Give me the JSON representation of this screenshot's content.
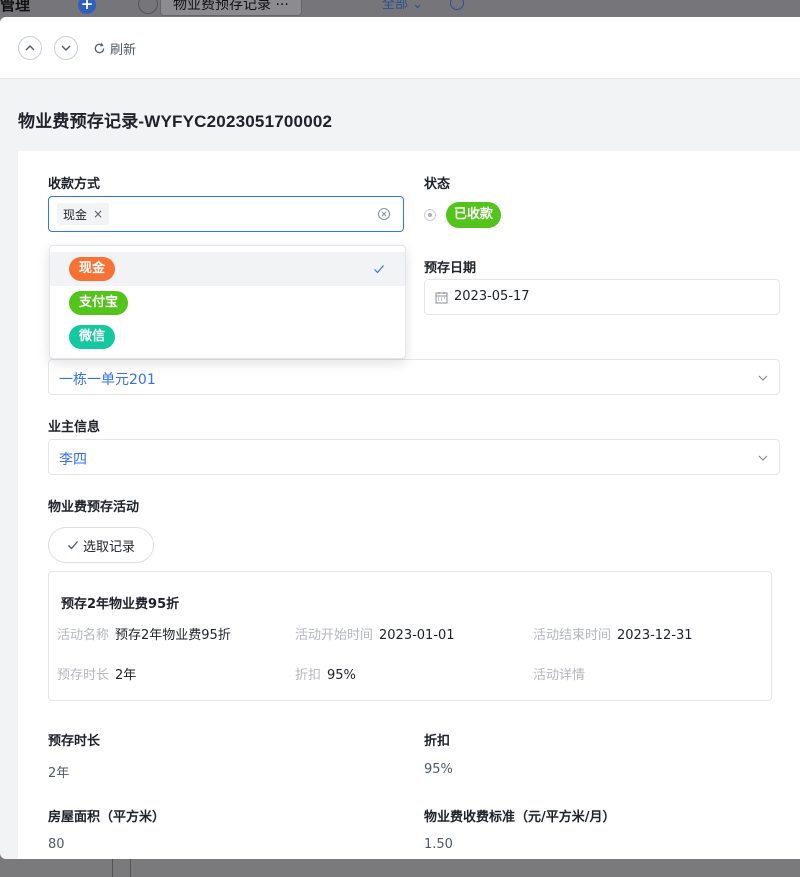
{
  "background": {
    "title": "管理",
    "more": "···",
    "plus": "+",
    "tab_label": "物业费预存记录",
    "tab_more": "···",
    "filter_label": "全部 ⌄"
  },
  "toolbar": {
    "refresh_label": "刷新"
  },
  "page": {
    "title": "物业费预存记录-WYFYC2023051700002"
  },
  "form": {
    "payment_method": {
      "label": "收款方式",
      "selected_tag": "现金",
      "remove": "×"
    },
    "status": {
      "label": "状态",
      "value": "已收款"
    },
    "prepay_date": {
      "label": "预存日期",
      "value": "2023-05-17"
    },
    "room": {
      "value": "一栋一单元201"
    },
    "owner": {
      "label": "业主信息",
      "value": "李四"
    },
    "activity_section": {
      "label": "物业费预存活动",
      "select_button": "选取记录"
    },
    "activity": {
      "title": "预存2年物业费95折",
      "name_key": "活动名称",
      "name_value": "预存2年物业费95折",
      "start_key": "活动开始时间",
      "start_value": "2023-01-01",
      "end_key": "活动结束时间",
      "end_value": "2023-12-31",
      "duration_key": "预存时长",
      "duration_value": "2年",
      "discount_key": "折扣",
      "discount_value": "95%",
      "detail_key": "活动详情"
    },
    "prepay_duration": {
      "label": "预存时长",
      "value": "2年"
    },
    "discount": {
      "label": "折扣",
      "value": "95%"
    },
    "area": {
      "label": "房屋面积（平方米）",
      "value": "80"
    },
    "fee_standard": {
      "label": "物业费收费标准（元/平方米/月）",
      "value": "1.50"
    }
  },
  "dropdown": {
    "options": [
      {
        "label": "现金",
        "color": "#f77234",
        "selected": true
      },
      {
        "label": "支付宝",
        "color": "#52c41a",
        "selected": false
      },
      {
        "label": "微信",
        "color": "#14c9a0",
        "selected": false
      }
    ]
  },
  "colors": {
    "primary": "#3370ff",
    "status_green": "#52c41a"
  }
}
